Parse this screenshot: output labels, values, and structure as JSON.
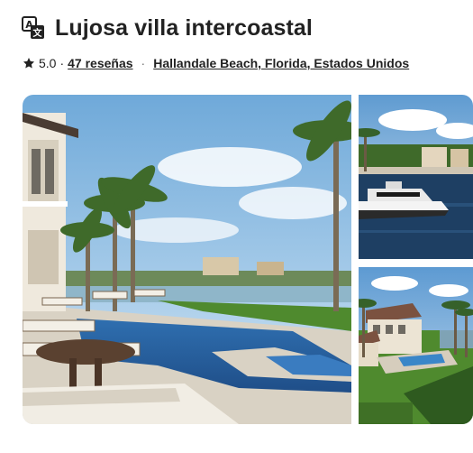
{
  "listing": {
    "title": "Lujosa villa intercoastal",
    "rating": "5.0",
    "separator": "·",
    "reviews_link": "47 reseñas",
    "location_link": "Hallandale Beach, Florida, Estados Unidos"
  },
  "icons": {
    "translate": "translate-icon",
    "star": "star-icon"
  },
  "photos": [
    {
      "name": "pool-terrace-photo"
    },
    {
      "name": "yacht-canal-photo"
    },
    {
      "name": "aerial-villa-photo"
    }
  ],
  "colors": {
    "text": "#222222",
    "muted": "#717171"
  }
}
